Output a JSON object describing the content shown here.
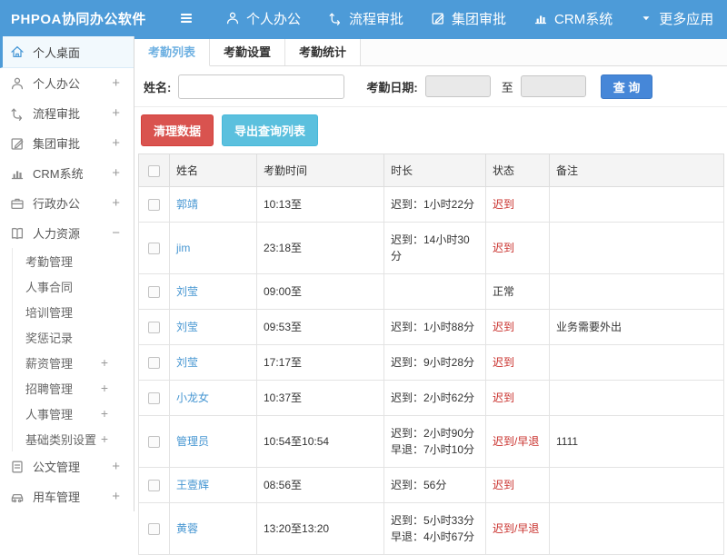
{
  "colors": {
    "topbar_blue": "#4d9bd8",
    "search_button_blue": "#4687d8",
    "danger_red": "#d9534f",
    "info_teal": "#5bc0de",
    "status_red": "#c9302c",
    "link_blue": "#4696d2",
    "active_tab_blue": "#6fb1e2"
  },
  "topbar": {
    "brand": "PHPOA协同办公软件",
    "nav": [
      {
        "label": "个人办公",
        "icon": "person-icon"
      },
      {
        "label": "流程审批",
        "icon": "flow-icon"
      },
      {
        "label": "集团审批",
        "icon": "edit-icon"
      },
      {
        "label": "CRM系统",
        "icon": "chart-icon"
      },
      {
        "label": "更多应用",
        "icon": "caret-down-icon"
      }
    ]
  },
  "sidebar": {
    "items": [
      {
        "label": "个人桌面",
        "icon": "home-icon",
        "active": true,
        "expandable": false
      },
      {
        "label": "个人办公",
        "icon": "person-icon",
        "expandable": true
      },
      {
        "label": "流程审批",
        "icon": "flow-icon",
        "expandable": true
      },
      {
        "label": "集团审批",
        "icon": "edit-icon",
        "expandable": true
      },
      {
        "label": "CRM系统",
        "icon": "chart-icon",
        "expandable": true
      },
      {
        "label": "行政办公",
        "icon": "briefcase-icon",
        "expandable": true
      },
      {
        "label": "人力资源",
        "icon": "book-icon",
        "expandable": false,
        "expanded": true,
        "collapse_sign": "−",
        "children": [
          {
            "label": "考勤管理",
            "expandable": false
          },
          {
            "label": "人事合同",
            "expandable": false
          },
          {
            "label": "培训管理",
            "expandable": false
          },
          {
            "label": "奖惩记录",
            "expandable": false
          },
          {
            "label": "薪资管理",
            "expandable": true
          },
          {
            "label": "招聘管理",
            "expandable": true
          },
          {
            "label": "人事管理",
            "expandable": true
          },
          {
            "label": "基础类别设置",
            "expandable": true
          }
        ]
      },
      {
        "label": "公文管理",
        "icon": "document-icon",
        "expandable": true
      },
      {
        "label": "用车管理",
        "icon": "car-icon",
        "expandable": true
      }
    ],
    "expand_sign": "+"
  },
  "tabs": [
    {
      "label": "考勤列表",
      "active": true
    },
    {
      "label": "考勤设置",
      "active": false
    },
    {
      "label": "考勤统计",
      "active": false
    }
  ],
  "filter": {
    "name_label": "姓名:",
    "name_value": "",
    "date_label": "考勤日期:",
    "date_from_value": "",
    "to_label": "至",
    "date_to_value": "",
    "search_button": "查 询"
  },
  "actions": {
    "clear_button": "清理数据",
    "export_button": "导出查询列表"
  },
  "table": {
    "headers": [
      "姓名",
      "考勤时间",
      "时长",
      "状态",
      "备注"
    ],
    "rows": [
      {
        "name": "郭靖",
        "time": "10:13至",
        "duration": [
          "迟到：1小时22分"
        ],
        "status": "迟到",
        "status_type": "late",
        "note": ""
      },
      {
        "name": "jim",
        "time": "23:18至",
        "duration": [
          "迟到：14小时30",
          "分"
        ],
        "status": "迟到",
        "status_type": "late",
        "note": ""
      },
      {
        "name": "刘莹",
        "time": "09:00至",
        "duration": [],
        "status": "正常",
        "status_type": "normal",
        "note": ""
      },
      {
        "name": "刘莹",
        "time": "09:53至",
        "duration": [
          "迟到：1小时88分"
        ],
        "status": "迟到",
        "status_type": "late",
        "note": "业务需要外出"
      },
      {
        "name": "刘莹",
        "time": "17:17至",
        "duration": [
          "迟到：9小时28分"
        ],
        "status": "迟到",
        "status_type": "late",
        "note": ""
      },
      {
        "name": "小龙女",
        "time": "10:37至",
        "duration": [
          "迟到：2小时62分"
        ],
        "status": "迟到",
        "status_type": "late",
        "note": ""
      },
      {
        "name": "管理员",
        "time": "10:54至10:54",
        "duration": [
          "迟到：2小时90分",
          "早退：7小时10分"
        ],
        "status": "迟到/早退",
        "status_type": "late",
        "note": "1111"
      },
      {
        "name": "王壹辉",
        "time": "08:56至",
        "duration": [
          "迟到：56分"
        ],
        "status": "迟到",
        "status_type": "late",
        "note": ""
      },
      {
        "name": "黄蓉",
        "time": "13:20至13:20",
        "duration": [
          "迟到：5小时33分",
          "早退：4小时67分"
        ],
        "status": "迟到/早退",
        "status_type": "late",
        "note": ""
      }
    ]
  }
}
